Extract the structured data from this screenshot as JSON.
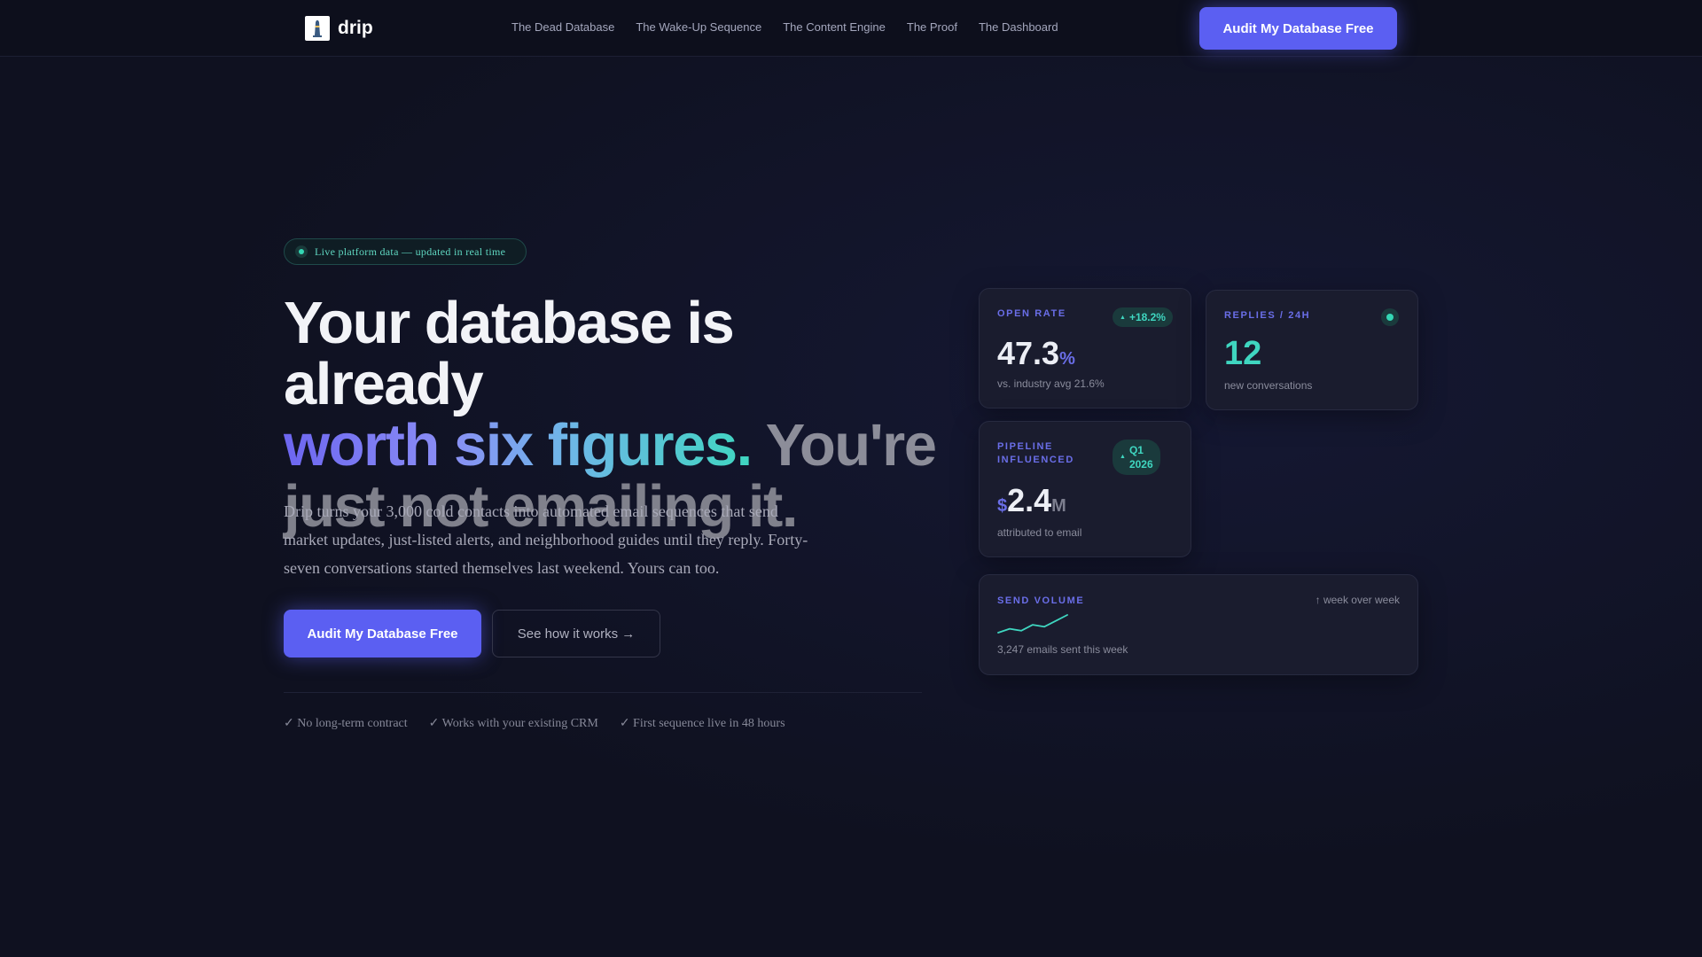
{
  "nav": {
    "logo_text": "drip",
    "links": [
      "The Dead Database",
      "The Wake-Up Sequence",
      "The Content Engine",
      "The Proof",
      "The Dashboard"
    ],
    "cta": "Audit My Database Free"
  },
  "hero": {
    "pill": "Live platform data — updated in real time",
    "headline": {
      "part1": "Your database is already",
      "part2": "worth six figures.",
      "part3": "You're",
      "part4": "just not emailing it."
    },
    "description": "Drip turns your 3,000 cold contacts into automated email sequences that send market updates, just-listed alerts, and neighborhood guides until they reply. Forty-seven conversations started themselves last weekend. Yours can too.",
    "primary_cta": "Audit My Database Free",
    "secondary_cta": "See how it works →",
    "checks": [
      "✓ No long-term contract",
      "✓ Works with your existing CRM",
      "✓ First sequence live in 48 hours"
    ]
  },
  "cards": {
    "open_rate": {
      "label": "OPEN RATE",
      "badge": "+18.2%",
      "value": "47.3",
      "unit": "%",
      "sub": "vs. industry avg 21.6%"
    },
    "replies": {
      "label": "REPLIES / 24H",
      "value": "12",
      "sub": "new conversations"
    },
    "pipeline": {
      "label_line1": "PIPELINE",
      "label_line2": "INFLUENCED",
      "badge_line1": "Q1",
      "badge_line2": "2026",
      "prefix": "$",
      "value": "2.4",
      "suffix": "M",
      "sub": "attributed to email"
    },
    "send_volume": {
      "label": "SEND VOLUME",
      "trend": "↑ week over week",
      "sub": "3,247 emails sent this week",
      "sparkline": [
        2,
        4,
        3,
        6,
        5,
        8,
        11
      ]
    }
  },
  "colors": {
    "accent": "#5b5ff2",
    "teal": "#3fd6c0",
    "background": "#0f1120",
    "card": "#1a1c2e"
  }
}
